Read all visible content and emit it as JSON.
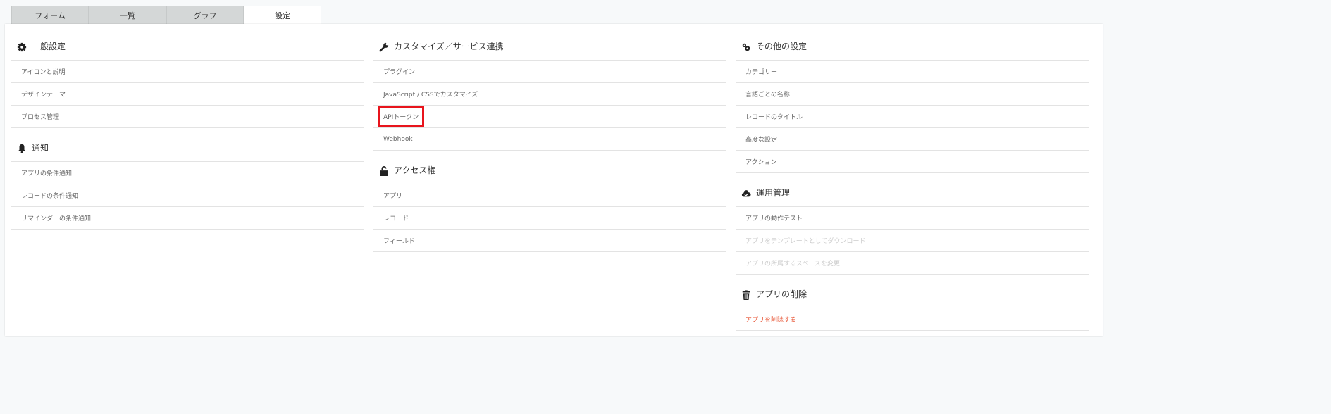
{
  "tabs": [
    {
      "label": "フォーム"
    },
    {
      "label": "一覧"
    },
    {
      "label": "グラフ"
    },
    {
      "label": "設定",
      "active": true
    }
  ],
  "columns": [
    [
      {
        "title": "一般設定",
        "icon": "gear-icon",
        "items": [
          {
            "label": "アイコンと説明"
          },
          {
            "label": "デザインテーマ"
          },
          {
            "label": "プロセス管理"
          }
        ]
      },
      {
        "title": "通知",
        "icon": "bell-icon",
        "items": [
          {
            "label": "アプリの条件通知"
          },
          {
            "label": "レコードの条件通知"
          },
          {
            "label": "リマインダーの条件通知"
          }
        ]
      }
    ],
    [
      {
        "title": "カスタマイズ／サービス連携",
        "icon": "wrench-icon",
        "items": [
          {
            "label": "プラグイン"
          },
          {
            "label": "JavaScript / CSSでカスタマイズ"
          },
          {
            "label": "APIトークン",
            "highlighted": true
          },
          {
            "label": "Webhook"
          }
        ]
      },
      {
        "title": "アクセス権",
        "icon": "lock-icon",
        "items": [
          {
            "label": "アプリ"
          },
          {
            "label": "レコード"
          },
          {
            "label": "フィールド"
          }
        ]
      }
    ],
    [
      {
        "title": "その他の設定",
        "icon": "gears-icon",
        "items": [
          {
            "label": "カテゴリー"
          },
          {
            "label": "言語ごとの名称"
          },
          {
            "label": "レコードのタイトル"
          },
          {
            "label": "高度な設定"
          },
          {
            "label": "アクション"
          }
        ]
      },
      {
        "title": "運用管理",
        "icon": "cloud-check-icon",
        "items": [
          {
            "label": "アプリの動作テスト"
          },
          {
            "label": "アプリをテンプレートとしてダウンロード",
            "disabled": true
          },
          {
            "label": "アプリの所属するスペースを変更",
            "disabled": true
          }
        ]
      },
      {
        "title": "アプリの削除",
        "icon": "trash-icon",
        "items": [
          {
            "label": "アプリを削除する",
            "danger": true
          }
        ]
      }
    ]
  ],
  "colors": {
    "highlight": "#e8141c",
    "danger": "#e8593a",
    "disabled": "#cccccc"
  }
}
